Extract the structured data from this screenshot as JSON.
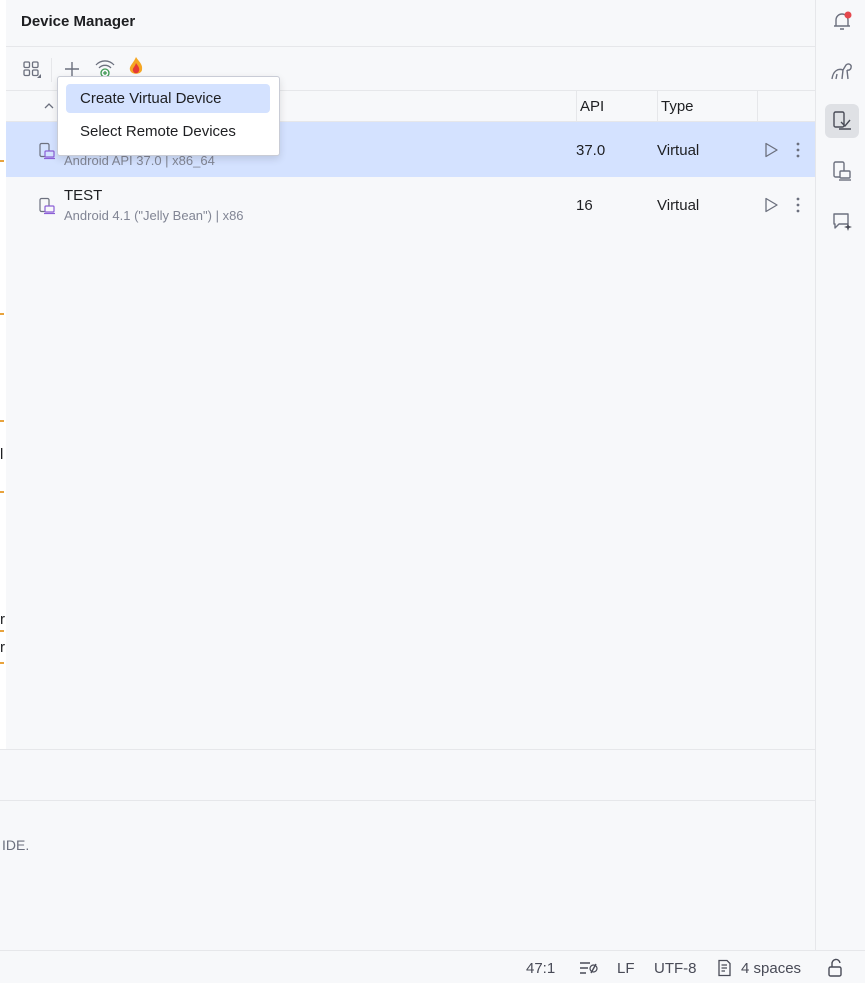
{
  "panel": {
    "title": "Device Manager"
  },
  "toolbar": {
    "icons": [
      "group-by-icon",
      "add-icon",
      "pair-wifi-icon",
      "firebase-icon"
    ]
  },
  "table": {
    "columns": {
      "api": "API",
      "type": "Type"
    },
    "rows": [
      {
        "name": "",
        "subtitle": "Android API 37.0 | x86_64",
        "api": "37.0",
        "type": "Virtual",
        "selected": true
      },
      {
        "name": "TEST",
        "subtitle": "Android 4.1 (\"Jelly Bean\") | x86",
        "api": "16",
        "type": "Virtual",
        "selected": false
      }
    ]
  },
  "menu": {
    "items": [
      {
        "label": "Create Virtual Device",
        "highlighted": true
      },
      {
        "label": "Select Remote Devices",
        "highlighted": false
      }
    ]
  },
  "background_text": {
    "ide_fragment": "IDE.",
    "fragment_1": "l",
    "fragment_2": "r",
    "fragment_3": "r"
  },
  "status_bar": {
    "position": "47:1",
    "line_ending": "LF",
    "encoding": "UTF-8",
    "indent": "4 spaces"
  },
  "right_toolbar": {
    "buttons": [
      "notifications-icon",
      "gradle-icon",
      "device-manager-icon",
      "running-devices-icon",
      "ai-assistant-icon"
    ],
    "active": "device-manager-icon"
  },
  "colors": {
    "selection": "#d4e2ff",
    "notification_dot": "#e5484d",
    "accent_purple": "#8b5fd6"
  }
}
